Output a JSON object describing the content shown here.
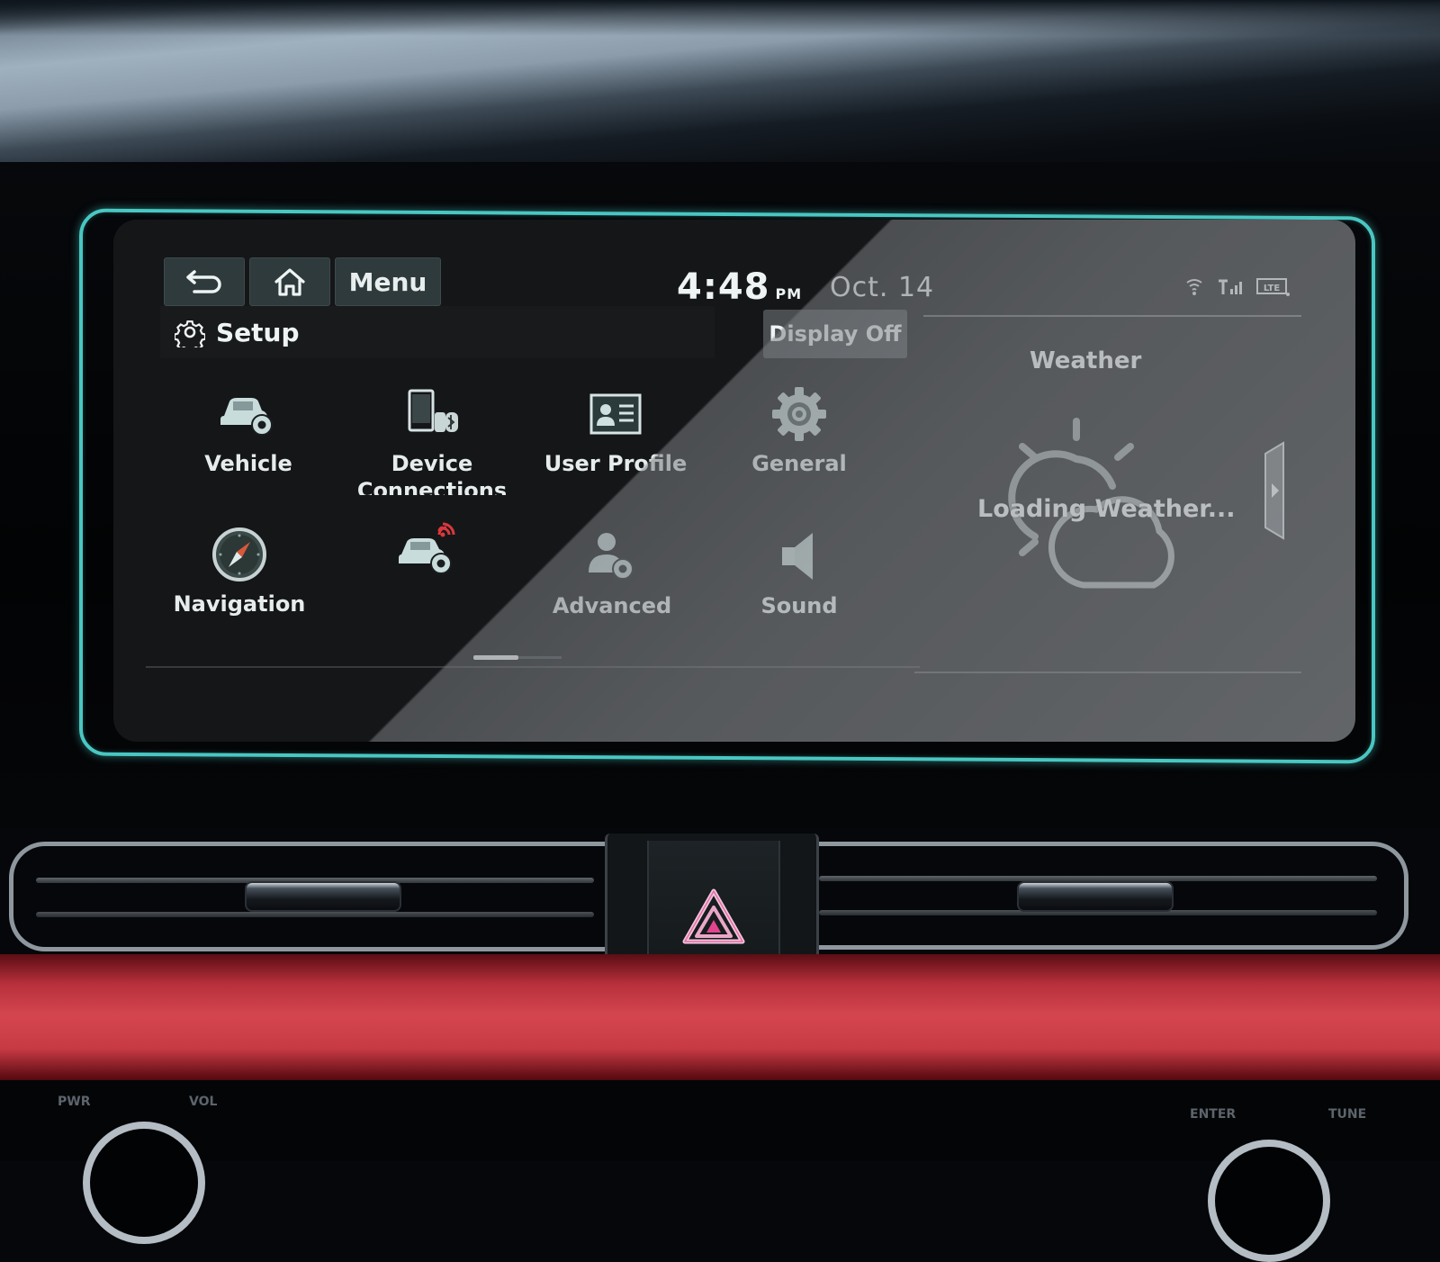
{
  "header": {
    "back_icon": "back-arrow-icon",
    "home_icon": "home-icon",
    "menu_label": "Menu",
    "time": "4:48",
    "ampm": "PM",
    "date": "Oct. 14",
    "status_icons": [
      "wifi-icon",
      "signal-bars-icon",
      "lte-icon"
    ],
    "lte_label": "LTE"
  },
  "setup": {
    "icon": "gear-icon",
    "title": "Setup",
    "display_off_label": "Display Off"
  },
  "menu_items": [
    {
      "label": "Vehicle",
      "icon": "car-gear-icon"
    },
    {
      "label": "Device Connections",
      "icon": "phone-bluetooth-icon"
    },
    {
      "label": "User Profile",
      "icon": "id-card-icon"
    },
    {
      "label": "General",
      "icon": "gear-icon"
    },
    {
      "label": "Navigation",
      "icon": "compass-icon"
    },
    {
      "label": "",
      "icon": "connected-car-icon"
    },
    {
      "label": "Advanced",
      "icon": "user-gear-icon"
    },
    {
      "label": "Sound",
      "icon": "speaker-icon"
    }
  ],
  "pagination": {
    "current_page": 1,
    "total_pages": 2
  },
  "weather": {
    "title": "Weather",
    "status": "Loading Weather...",
    "icon": "partly-cloudy-icon",
    "next_icon": "chevron-right-icon"
  },
  "colors": {
    "protector_edge": "#49c7c2",
    "hazard": "#e0458e",
    "trim_red": "#d4454f",
    "connected_signal": "#d9383c"
  },
  "console": {
    "labels": [
      "PWR",
      "VOL",
      "ENTER",
      "TUNE"
    ]
  }
}
